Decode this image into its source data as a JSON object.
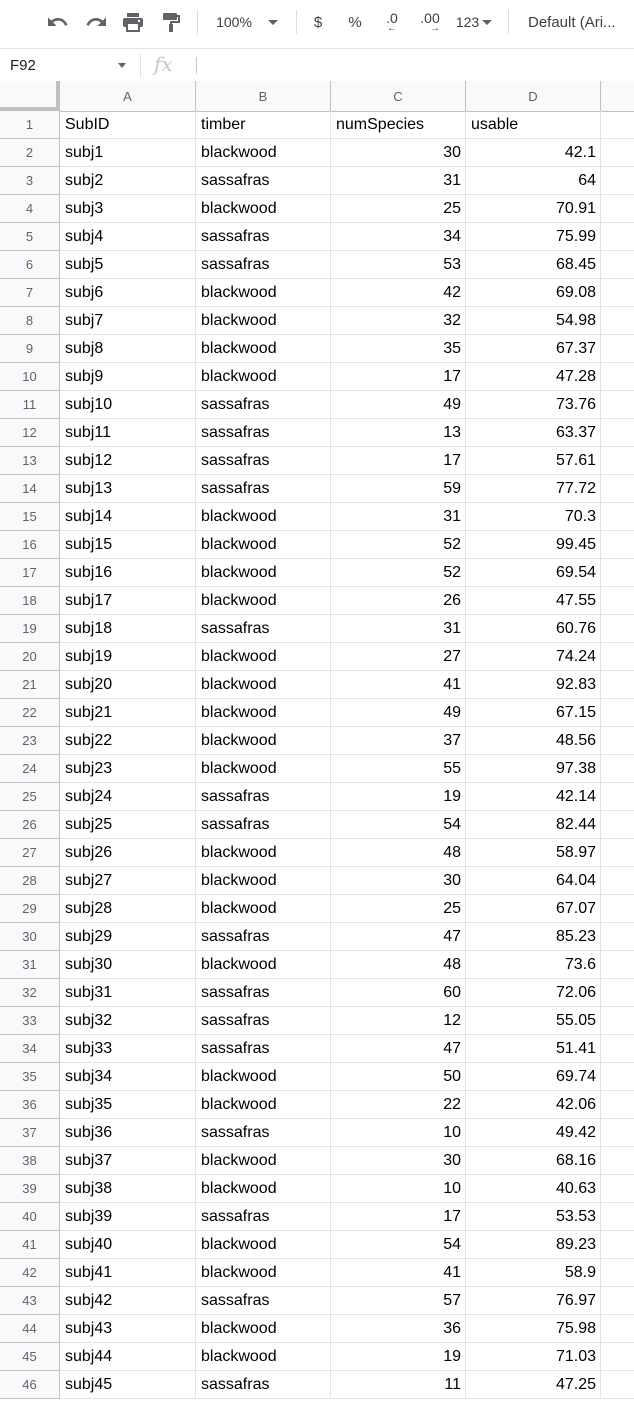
{
  "toolbar": {
    "undo_icon": "undo-icon",
    "redo_icon": "redo-icon",
    "print_icon": "print-icon",
    "paint_format_icon": "paint-format-icon",
    "zoom": "100%",
    "currency": "$",
    "percent": "%",
    "decrease_decimal": ".0",
    "increase_decimal": ".00",
    "number_format": "123",
    "font": "Default (Ari..."
  },
  "formula_bar": {
    "cell_ref": "F92",
    "fx_label": "fx",
    "value": ""
  },
  "columns": [
    "A",
    "B",
    "C",
    "D"
  ],
  "rows": [
    {
      "n": "1",
      "a": "SubID",
      "b": "timber",
      "c": "numSpecies",
      "d": "usable",
      "header": true
    },
    {
      "n": "2",
      "a": "subj1",
      "b": "blackwood",
      "c": "30",
      "d": "42.1"
    },
    {
      "n": "3",
      "a": "subj2",
      "b": "sassafras",
      "c": "31",
      "d": "64"
    },
    {
      "n": "4",
      "a": "subj3",
      "b": "blackwood",
      "c": "25",
      "d": "70.91"
    },
    {
      "n": "5",
      "a": "subj4",
      "b": "sassafras",
      "c": "34",
      "d": "75.99"
    },
    {
      "n": "6",
      "a": "subj5",
      "b": "sassafras",
      "c": "53",
      "d": "68.45"
    },
    {
      "n": "7",
      "a": "subj6",
      "b": "blackwood",
      "c": "42",
      "d": "69.08"
    },
    {
      "n": "8",
      "a": "subj7",
      "b": "blackwood",
      "c": "32",
      "d": "54.98"
    },
    {
      "n": "9",
      "a": "subj8",
      "b": "blackwood",
      "c": "35",
      "d": "67.37"
    },
    {
      "n": "10",
      "a": "subj9",
      "b": "blackwood",
      "c": "17",
      "d": "47.28"
    },
    {
      "n": "11",
      "a": "subj10",
      "b": "sassafras",
      "c": "49",
      "d": "73.76"
    },
    {
      "n": "12",
      "a": "subj11",
      "b": "sassafras",
      "c": "13",
      "d": "63.37"
    },
    {
      "n": "13",
      "a": "subj12",
      "b": "sassafras",
      "c": "17",
      "d": "57.61"
    },
    {
      "n": "14",
      "a": "subj13",
      "b": "sassafras",
      "c": "59",
      "d": "77.72"
    },
    {
      "n": "15",
      "a": "subj14",
      "b": "blackwood",
      "c": "31",
      "d": "70.3"
    },
    {
      "n": "16",
      "a": "subj15",
      "b": "blackwood",
      "c": "52",
      "d": "99.45"
    },
    {
      "n": "17",
      "a": "subj16",
      "b": "blackwood",
      "c": "52",
      "d": "69.54"
    },
    {
      "n": "18",
      "a": "subj17",
      "b": "blackwood",
      "c": "26",
      "d": "47.55"
    },
    {
      "n": "19",
      "a": "subj18",
      "b": "sassafras",
      "c": "31",
      "d": "60.76"
    },
    {
      "n": "20",
      "a": "subj19",
      "b": "blackwood",
      "c": "27",
      "d": "74.24"
    },
    {
      "n": "21",
      "a": "subj20",
      "b": "blackwood",
      "c": "41",
      "d": "92.83"
    },
    {
      "n": "22",
      "a": "subj21",
      "b": "blackwood",
      "c": "49",
      "d": "67.15"
    },
    {
      "n": "23",
      "a": "subj22",
      "b": "blackwood",
      "c": "37",
      "d": "48.56"
    },
    {
      "n": "24",
      "a": "subj23",
      "b": "blackwood",
      "c": "55",
      "d": "97.38"
    },
    {
      "n": "25",
      "a": "subj24",
      "b": "sassafras",
      "c": "19",
      "d": "42.14"
    },
    {
      "n": "26",
      "a": "subj25",
      "b": "sassafras",
      "c": "54",
      "d": "82.44"
    },
    {
      "n": "27",
      "a": "subj26",
      "b": "blackwood",
      "c": "48",
      "d": "58.97"
    },
    {
      "n": "28",
      "a": "subj27",
      "b": "blackwood",
      "c": "30",
      "d": "64.04"
    },
    {
      "n": "29",
      "a": "subj28",
      "b": "blackwood",
      "c": "25",
      "d": "67.07"
    },
    {
      "n": "30",
      "a": "subj29",
      "b": "sassafras",
      "c": "47",
      "d": "85.23"
    },
    {
      "n": "31",
      "a": "subj30",
      "b": "blackwood",
      "c": "48",
      "d": "73.6"
    },
    {
      "n": "32",
      "a": "subj31",
      "b": "sassafras",
      "c": "60",
      "d": "72.06"
    },
    {
      "n": "33",
      "a": "subj32",
      "b": "sassafras",
      "c": "12",
      "d": "55.05"
    },
    {
      "n": "34",
      "a": "subj33",
      "b": "sassafras",
      "c": "47",
      "d": "51.41"
    },
    {
      "n": "35",
      "a": "subj34",
      "b": "blackwood",
      "c": "50",
      "d": "69.74"
    },
    {
      "n": "36",
      "a": "subj35",
      "b": "blackwood",
      "c": "22",
      "d": "42.06"
    },
    {
      "n": "37",
      "a": "subj36",
      "b": "sassafras",
      "c": "10",
      "d": "49.42"
    },
    {
      "n": "38",
      "a": "subj37",
      "b": "blackwood",
      "c": "30",
      "d": "68.16"
    },
    {
      "n": "39",
      "a": "subj38",
      "b": "blackwood",
      "c": "10",
      "d": "40.63"
    },
    {
      "n": "40",
      "a": "subj39",
      "b": "sassafras",
      "c": "17",
      "d": "53.53"
    },
    {
      "n": "41",
      "a": "subj40",
      "b": "blackwood",
      "c": "54",
      "d": "89.23"
    },
    {
      "n": "42",
      "a": "subj41",
      "b": "blackwood",
      "c": "41",
      "d": "58.9"
    },
    {
      "n": "43",
      "a": "subj42",
      "b": "sassafras",
      "c": "57",
      "d": "76.97"
    },
    {
      "n": "44",
      "a": "subj43",
      "b": "blackwood",
      "c": "36",
      "d": "75.98"
    },
    {
      "n": "45",
      "a": "subj44",
      "b": "blackwood",
      "c": "19",
      "d": "71.03"
    },
    {
      "n": "46",
      "a": "subj45",
      "b": "sassafras",
      "c": "11",
      "d": "47.25"
    }
  ]
}
